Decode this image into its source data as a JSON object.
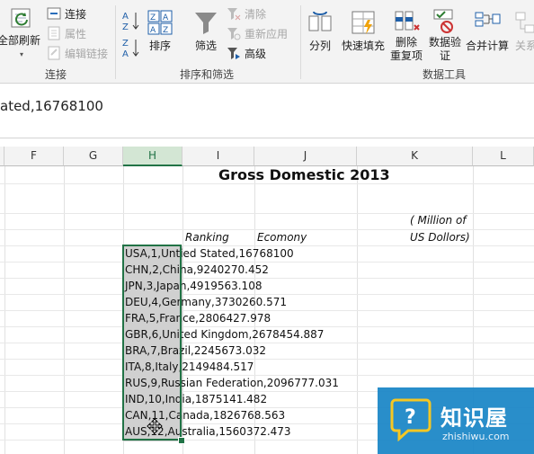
{
  "ribbon": {
    "refresh_all": "全部刷新",
    "connections": "连接",
    "properties": "属性",
    "edit_links": "编辑链接",
    "group_connections": "连接",
    "sort": "排序",
    "filter": "筛选",
    "clear": "清除",
    "reapply": "重新应用",
    "advanced": "高级",
    "group_sort_filter": "排序和筛选",
    "text_to_columns": "分列",
    "flash_fill": "快速填充",
    "remove_duplicates_1": "删除",
    "remove_duplicates_2": "重复项",
    "data_validation_1": "数据验",
    "data_validation_2": "证",
    "consolidate": "合并计算",
    "relationships": "关系",
    "group_data_tools": "数据工具",
    "sort_az_top": "A",
    "sort_az_bottom": "Z",
    "sort_za_top": "Z",
    "sort_za_bottom": "A"
  },
  "formula_bar": {
    "content": "ated,16768100"
  },
  "columns": [
    "F",
    "G",
    "H",
    "I",
    "J",
    "K",
    "L"
  ],
  "sheet": {
    "title": "Gross Domestic 2013",
    "unit_line1": "( Million of",
    "unit_line2": "US Dollors)",
    "header_ranking": "Ranking",
    "header_economy": "Ecomony",
    "rows": [
      "USA,1,Untied Stated,16768100",
      "CHN,2,China,9240270.452",
      "JPN,3,Japan,4919563.108",
      "DEU,4,Germany,3730260.571",
      "FRA,5,France,2806427.978",
      "GBR,6,United Kingdom,2678454.887",
      "BRA,7,Brazil,2245673.032",
      "ITA,8,Italy,2149484.517",
      "RUS,9,Russian Federation,2096777.031",
      "IND,10,India,1875141.482",
      "CAN,11,Canada,1826768.563",
      "AUS,12,Australia,1560372.473"
    ]
  },
  "watermark": {
    "name": "知识屋",
    "url": "zhishiwu.com"
  },
  "colors": {
    "excel_green": "#217346",
    "watermark_blue": "#1e88c8"
  }
}
